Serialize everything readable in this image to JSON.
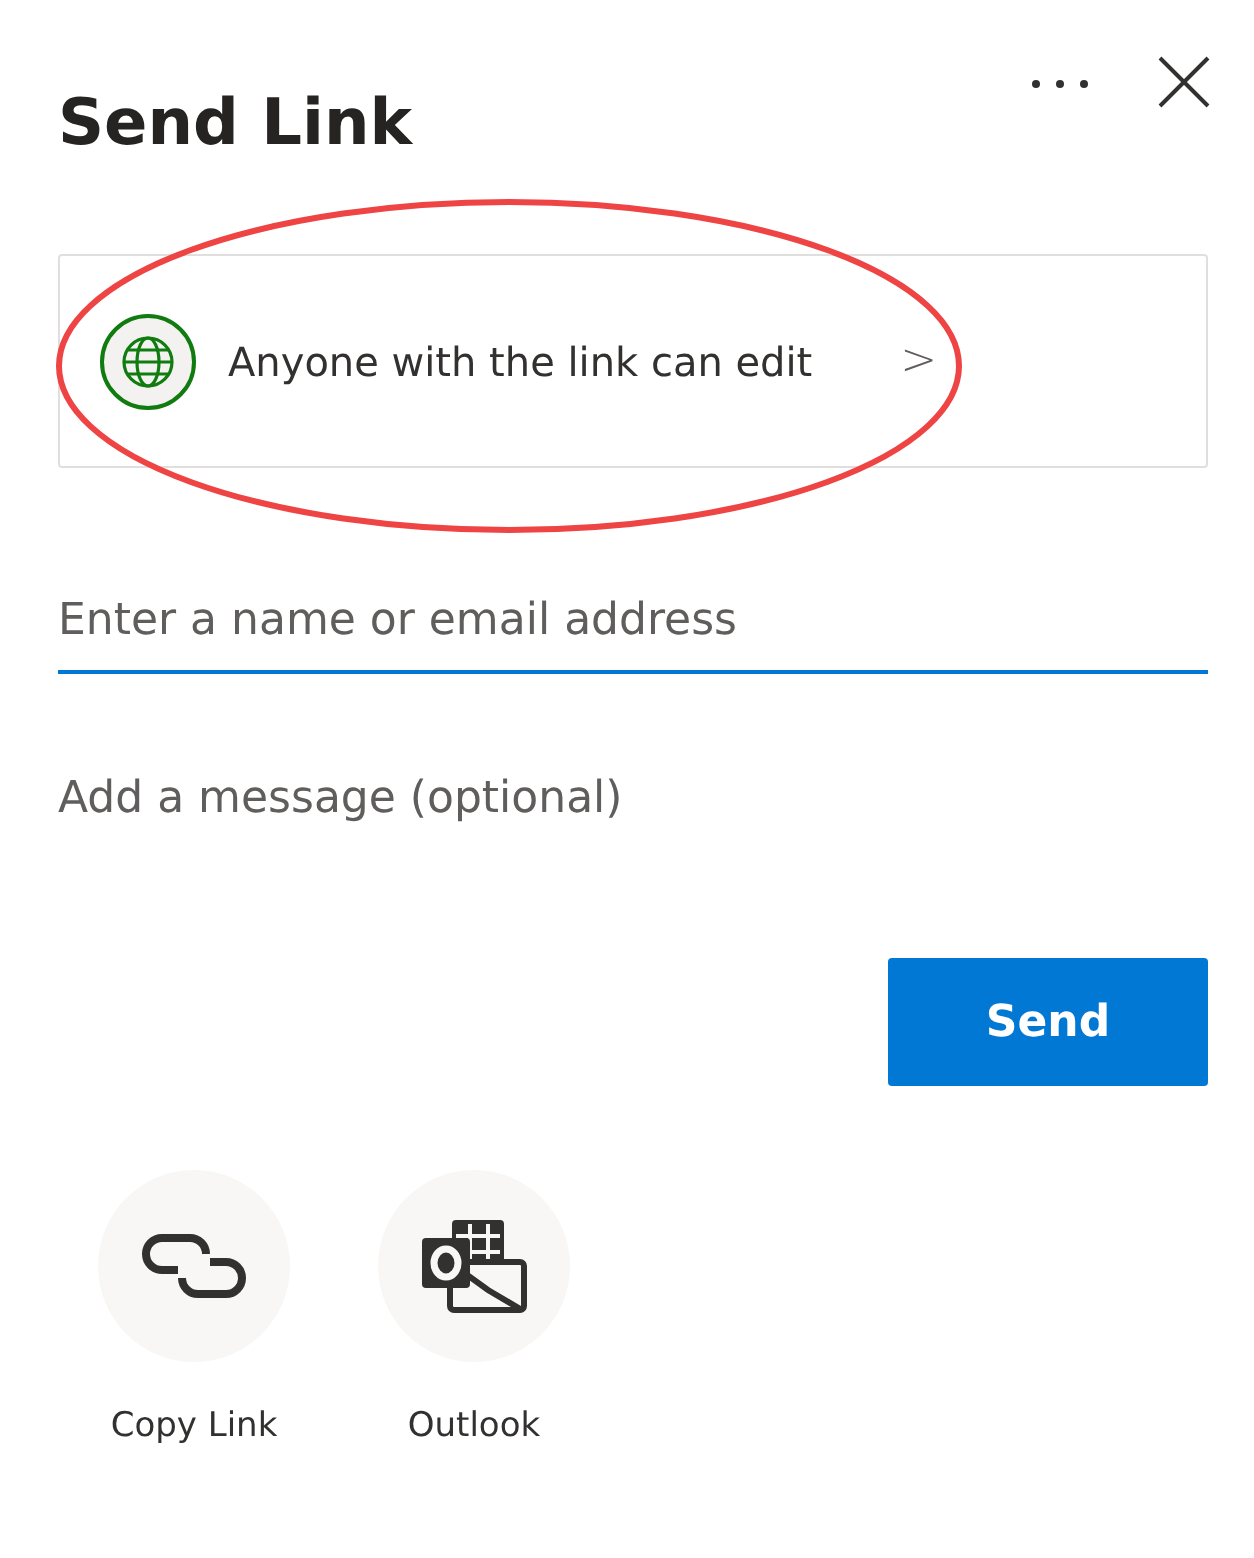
{
  "title": "Send Link",
  "link_settings": {
    "label": "Anyone with the link can edit",
    "chevron": ">"
  },
  "recipient": {
    "placeholder": "Enter a name or email address"
  },
  "message": {
    "placeholder": "Add a message (optional)"
  },
  "send_button": "Send",
  "share_options": [
    {
      "kind": "copy",
      "label": "Copy Link"
    },
    {
      "kind": "outlook",
      "label": "Outlook"
    }
  ]
}
